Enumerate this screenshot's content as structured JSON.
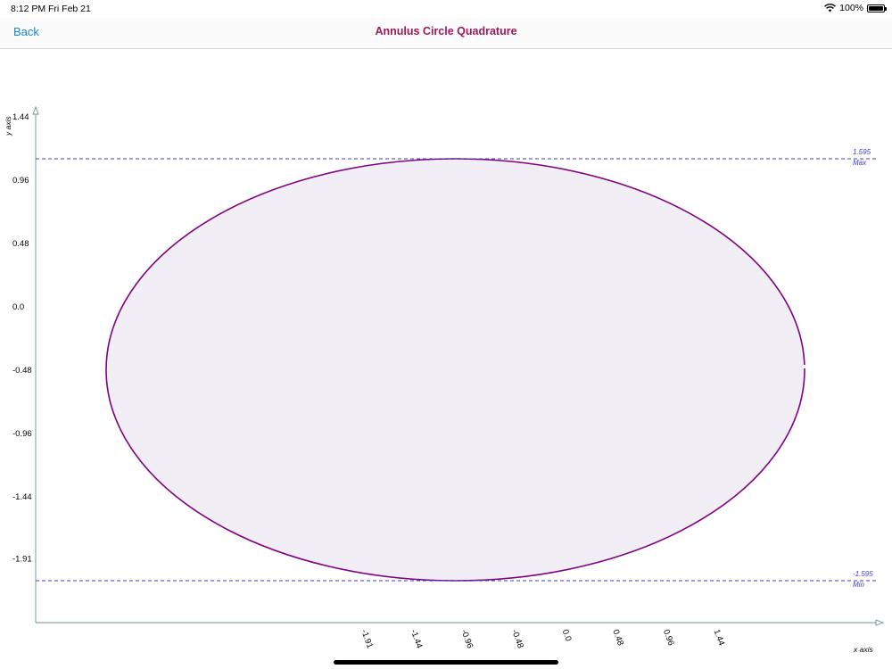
{
  "status_bar": {
    "time": "8:12 PM",
    "date": "Fri Feb 21",
    "battery": "100%",
    "icons": [
      "wifi-icon",
      "battery-icon"
    ]
  },
  "nav": {
    "back_label": "Back",
    "title": "Annulus Circle Quadrature"
  },
  "colors": {
    "nav_link": "#1a83d8",
    "title": "#9a1a5a",
    "curve": "#800080",
    "fill": "#f1eef5",
    "reference_line": "#3b3bd8",
    "axis": "#6c8d8d"
  },
  "chart_data": {
    "type": "line",
    "title": "",
    "xlabel": "x axis",
    "ylabel": "y axis",
    "x_ticks": [
      "-1.91",
      "-1.44",
      "-0.96",
      "-0.48",
      "0.0",
      "0.48",
      "0.96",
      "1.44"
    ],
    "y_ticks": [
      "1.44",
      "0.96",
      "0.48",
      "0.0",
      "-0.48",
      "-0.96",
      "-1.44",
      "-1.91"
    ],
    "xlim": [
      -2.4,
      1.44
    ],
    "ylim": [
      -2.39,
      1.44
    ],
    "grid": false,
    "series": [
      {
        "shape": "ellipse",
        "center": [
          -0.48,
          -0.48
        ],
        "radius_x": 1.595,
        "radius_y": 1.595,
        "filled": true
      }
    ],
    "reference_lines": [
      {
        "value_label": "1.595",
        "label": "Max"
      },
      {
        "value_label": "-1.595",
        "label": "Min"
      }
    ]
  }
}
